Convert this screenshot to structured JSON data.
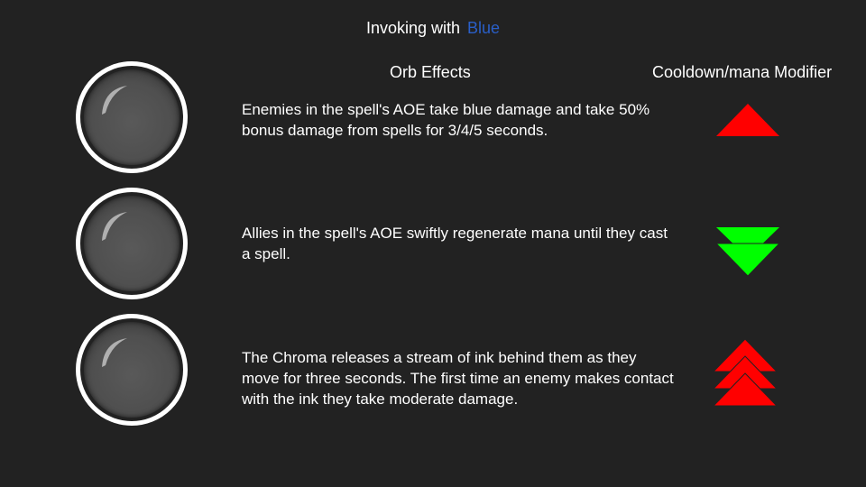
{
  "title": {
    "prefix": "Invoking with",
    "color_word": "Blue",
    "color_word_hex": "#2a5fc8"
  },
  "headers": {
    "effects": "Orb Effects",
    "modifier": "Cooldown/mana Modifier"
  },
  "rows": [
    {
      "effect": "Enemies in the spell's AOE take blue damage and take 50% bonus damage from spells for 3/4/5 seconds.",
      "modifier_icon": "single-red-up-arrow-icon",
      "modifier_color": "#ff0000"
    },
    {
      "effect": "Allies in the spell's AOE swiftly regenerate mana until they cast a spell.",
      "modifier_icon": "double-green-down-arrow-icon",
      "modifier_color": "#00ff00"
    },
    {
      "effect": "The Chroma releases a stream of ink behind them as they move for three seconds. The first time an enemy makes contact with the ink they take moderate damage.",
      "modifier_icon": "triple-red-up-arrow-icon",
      "modifier_color": "#ff0000"
    }
  ],
  "colors": {
    "background": "#222222",
    "text": "#ffffff",
    "orb_ring": "#ffffff",
    "orb_fill": "#505050"
  }
}
